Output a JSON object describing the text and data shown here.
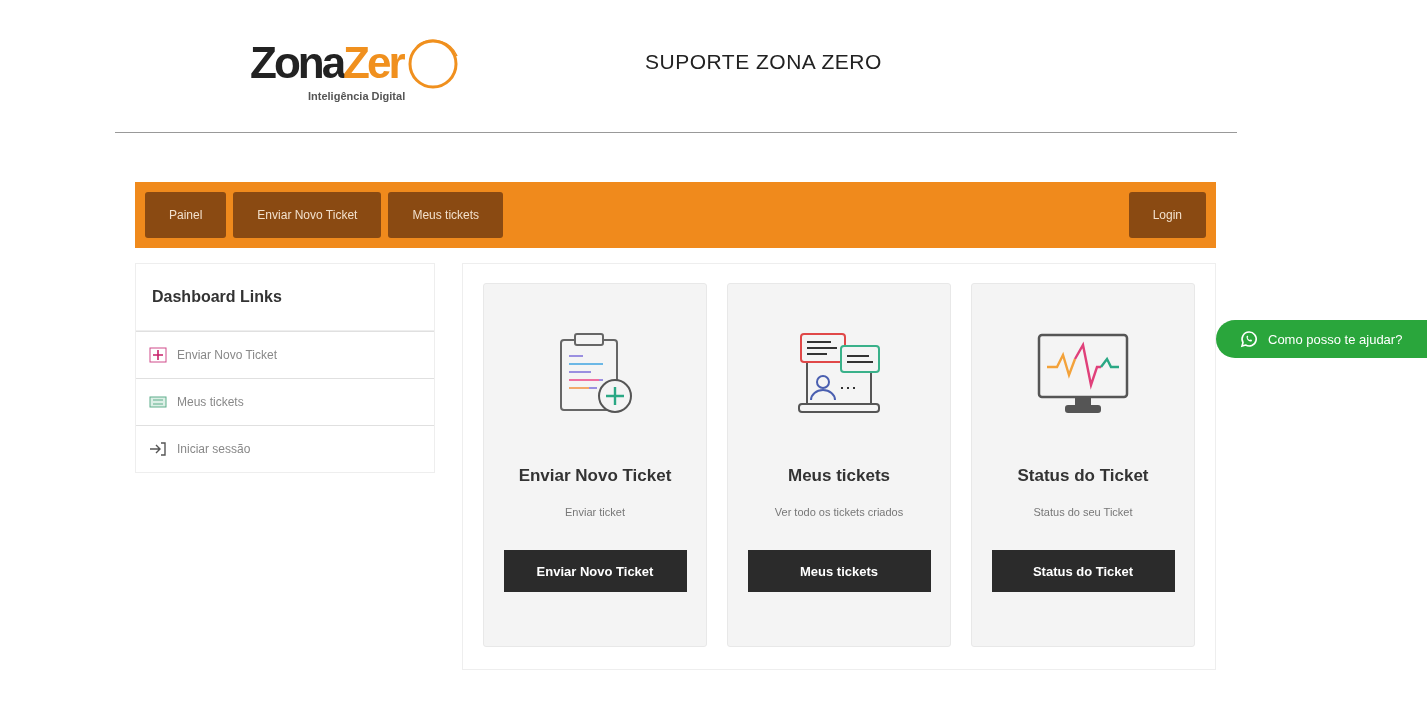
{
  "header": {
    "logo": {
      "dark": "Zona",
      "accent": "Zer",
      "tagline": "Inteligência Digital"
    },
    "title": "SUPORTE ZONA ZERO"
  },
  "nav": {
    "left": [
      "Painel",
      "Enviar Novo Ticket",
      "Meus tickets"
    ],
    "right": [
      "Login"
    ]
  },
  "sidebar": {
    "title": "Dashboard Links",
    "items": [
      {
        "label": "Enviar Novo Ticket"
      },
      {
        "label": "Meus tickets"
      },
      {
        "label": "Iniciar sessão"
      }
    ]
  },
  "cards": [
    {
      "title": "Enviar Novo Ticket",
      "subtitle": "Enviar ticket",
      "button": "Enviar Novo Ticket"
    },
    {
      "title": "Meus tickets",
      "subtitle": "Ver todo os tickets criados",
      "button": "Meus tickets"
    },
    {
      "title": "Status do Ticket",
      "subtitle": "Status do seu Ticket",
      "button": "Status do Ticket"
    }
  ],
  "chat_button": {
    "label": "Como posso te ajudar?"
  }
}
